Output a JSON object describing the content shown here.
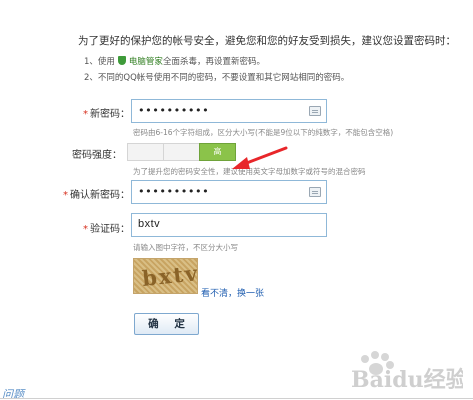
{
  "intro": "为了更好的保护您的帐号安全，避免您和您的好友受到损失，建议您设置密码时：",
  "tips": [
    {
      "prefix": "1、使用",
      "link": "电脑管家",
      "suffix": "全面杀毒，再设置新密码。"
    },
    {
      "text": "2、不同的QQ帐号使用不同的密码，不要设置和其它网站相同的密码。"
    }
  ],
  "form": {
    "required_mark": "*",
    "new_password": {
      "label": "新密码：",
      "value": "••••••••••",
      "hint": "密码由6-16个字符组成，区分大小写(不能是9位以下的纯数字，不能包含空格)"
    },
    "strength": {
      "label": "密码强度：",
      "level_text": "高",
      "level": 3,
      "levels_total": 3,
      "hint": "为了提升您的密码安全性，建议使用英文字母加数字或符号的混合密码"
    },
    "confirm_password": {
      "label": "确认新密码：",
      "value": "••••••••••"
    },
    "captcha": {
      "label": "验证码：",
      "value": "bxtv",
      "hint": "请输入图中字符，不区分大小写",
      "image_text": "bxtv",
      "refresh_label": "看不清，换一张"
    },
    "submit_label": "确 定"
  },
  "footer": {
    "link": "问题"
  },
  "watermark": {
    "text": "Baidu经验"
  },
  "colors": {
    "required": "#d7301f",
    "strength_on": "#8bc34a",
    "arrow": "#e8262a",
    "link": "#1f5eb0"
  },
  "icons": [
    "shield-icon",
    "keyboard-icon",
    "arrow-annotation-icon"
  ]
}
